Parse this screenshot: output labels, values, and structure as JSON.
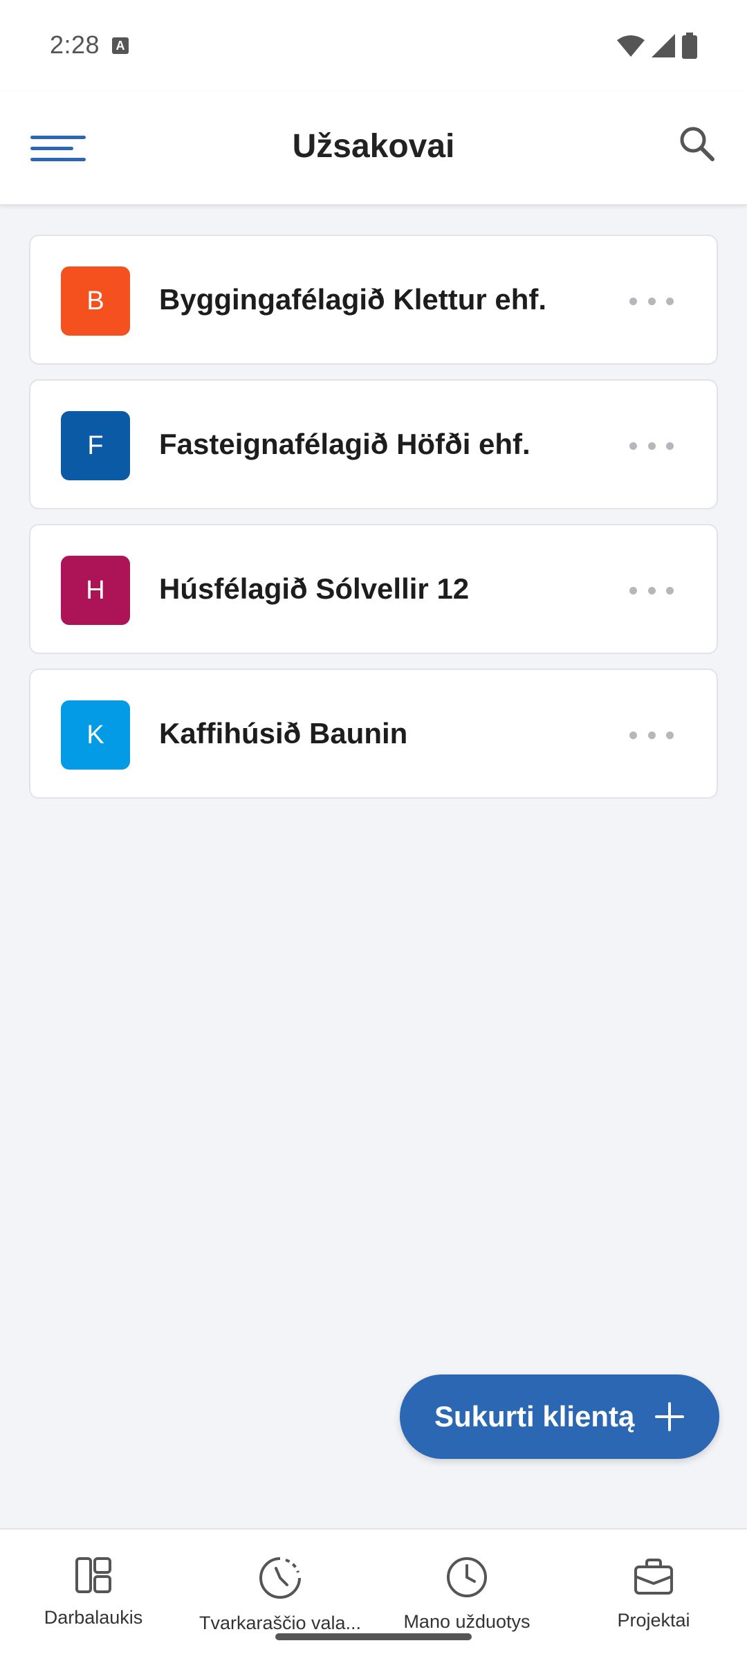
{
  "status_bar": {
    "time": "2:28",
    "notification_glyph": "A",
    "icons": [
      "wifi-icon",
      "signal-icon",
      "battery-icon"
    ]
  },
  "app_bar": {
    "title": "Užsakovai",
    "menu_icon": "hamburger-menu-icon",
    "search_icon": "search-icon"
  },
  "clients": [
    {
      "initial": "B",
      "name": "Byggingafélagið Klettur ehf.",
      "color": "#f4511e"
    },
    {
      "initial": "F",
      "name": "Fasteignafélagið Höfði ehf.",
      "color": "#0b5aa5"
    },
    {
      "initial": "H",
      "name": "Húsfélagið Sólvellir 12",
      "color": "#ad1457"
    },
    {
      "initial": "K",
      "name": "Kaffihúsið Baunin",
      "color": "#039be5"
    }
  ],
  "fab": {
    "label": "Sukurti klientą",
    "icon": "plus-icon"
  },
  "bottom_nav": [
    {
      "label": "Darbalaukis",
      "icon": "dashboard-icon"
    },
    {
      "label": "Tvarkaraščio vala...",
      "icon": "timesheet-clock-icon"
    },
    {
      "label": "Mano užduotys",
      "icon": "clock-icon"
    },
    {
      "label": "Projektai",
      "icon": "briefcase-icon"
    }
  ],
  "colors": {
    "accent": "#2b67b2",
    "background": "#f3f4f7"
  }
}
